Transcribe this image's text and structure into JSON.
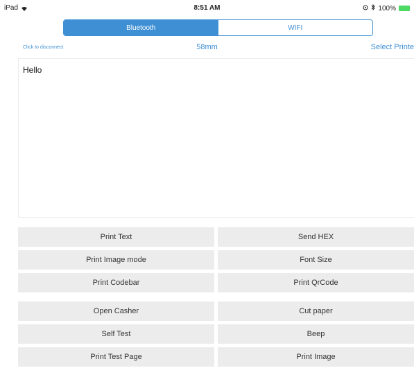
{
  "status_bar": {
    "device": "iPad",
    "time": "8:51 AM",
    "battery_text": "100%",
    "icons": [
      "wifi-icon",
      "location-icon",
      "bluetooth-icon",
      "battery-icon"
    ]
  },
  "segments": [
    {
      "label": "Bluetooth",
      "selected": true
    },
    {
      "label": "WIFI",
      "selected": false
    }
  ],
  "info_row": {
    "disconnect": "Click to disconnect",
    "paper_size": "58mm",
    "select_printer": "Select Printe"
  },
  "text_input": {
    "value": "Hello"
  },
  "buttons": [
    [
      "Print Text",
      "Send HEX"
    ],
    [
      "Print Image mode",
      "Font Size"
    ],
    [
      "Print Codebar",
      "Print QrCode"
    ],
    [
      "Open Casher",
      "Cut paper"
    ],
    [
      "Self Test",
      "Beep"
    ],
    [
      "Print Test Page",
      "Print Image"
    ]
  ],
  "colors": {
    "accent": "#3e8fd4",
    "button_bg": "#ececec",
    "battery": "#4cd964"
  }
}
